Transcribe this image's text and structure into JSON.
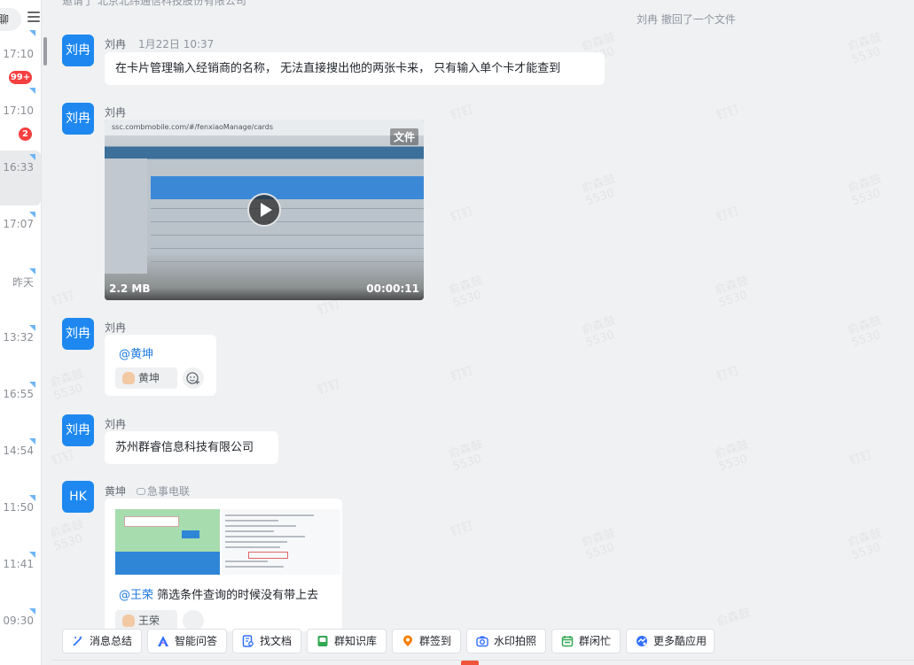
{
  "sidebar": {
    "search_tail": "聊",
    "conversations": [
      {
        "time": "17:10",
        "badge": "99+",
        "active": false
      },
      {
        "time": "17:10",
        "badge": "2",
        "active": false
      },
      {
        "time": "16:33",
        "badge": "",
        "active": true
      },
      {
        "time": "17:07",
        "badge": "",
        "active": false
      },
      {
        "time": "昨天",
        "badge": "",
        "active": false
      },
      {
        "time": "13:32",
        "badge": "",
        "active": false
      },
      {
        "time": "16:55",
        "badge": "",
        "active": false
      },
      {
        "time": "14:54",
        "badge": "",
        "active": false
      },
      {
        "time": "11:50",
        "badge": "",
        "active": false
      },
      {
        "time": "11:41",
        "badge": "",
        "active": false
      },
      {
        "time": "09:30",
        "badge": "",
        "active": false
      }
    ]
  },
  "chat": {
    "top_line": "邀请了 北京北纬通信科技股份有限公司",
    "recall_notice": "刘冉 撤回了一个文件",
    "watermark": {
      "name": "俞森鼓",
      "id": "5530",
      "app": "钉钉"
    },
    "messages": [
      {
        "avatar": "刘冉",
        "sender": "刘冉",
        "timestamp": "1月22日 10:37",
        "text": "在卡片管理输入经销商的名称， 无法直接搜出他的两张卡来， 只有输入单个卡才能查到"
      },
      {
        "avatar": "刘冉",
        "sender": "刘冉",
        "video": {
          "url": "ssc.combmobile.com/#/fenxiaoManage/cards",
          "tag": "文件",
          "size": "2.2 MB",
          "duration": "00:00:11"
        }
      },
      {
        "avatar": "刘冉",
        "sender": "刘冉",
        "mention": "@黄坤",
        "reaction_name": "黄坤"
      },
      {
        "avatar": "刘冉",
        "sender": "刘冉",
        "text": "苏州群睿信息科技有限公司"
      },
      {
        "avatar": "HK",
        "sender": "黄坤",
        "status": "急事电联",
        "mention": "@王荣",
        "text": " 筛选条件查询的时候没有带上去",
        "reaction_name": "王荣"
      }
    ]
  },
  "toolbar": {
    "items": [
      {
        "label": "消息总结",
        "icon": "summary-icon",
        "color": "#3370ff"
      },
      {
        "label": "智能问答",
        "icon": "ai-answer-icon",
        "color": "#3370ff"
      },
      {
        "label": "找文档",
        "icon": "find-doc-icon",
        "color": "#3370ff"
      },
      {
        "label": "群知识库",
        "icon": "knowledge-base-icon",
        "color": "#34a853"
      },
      {
        "label": "群签到",
        "icon": "checkin-icon",
        "color": "#f77f00"
      },
      {
        "label": "水印拍照",
        "icon": "camera-icon",
        "color": "#3370ff"
      },
      {
        "label": "群闲忙",
        "icon": "calendar-icon",
        "color": "#34a853"
      },
      {
        "label": "更多酷应用",
        "icon": "more-apps-icon",
        "color": "#3370ff"
      }
    ]
  }
}
